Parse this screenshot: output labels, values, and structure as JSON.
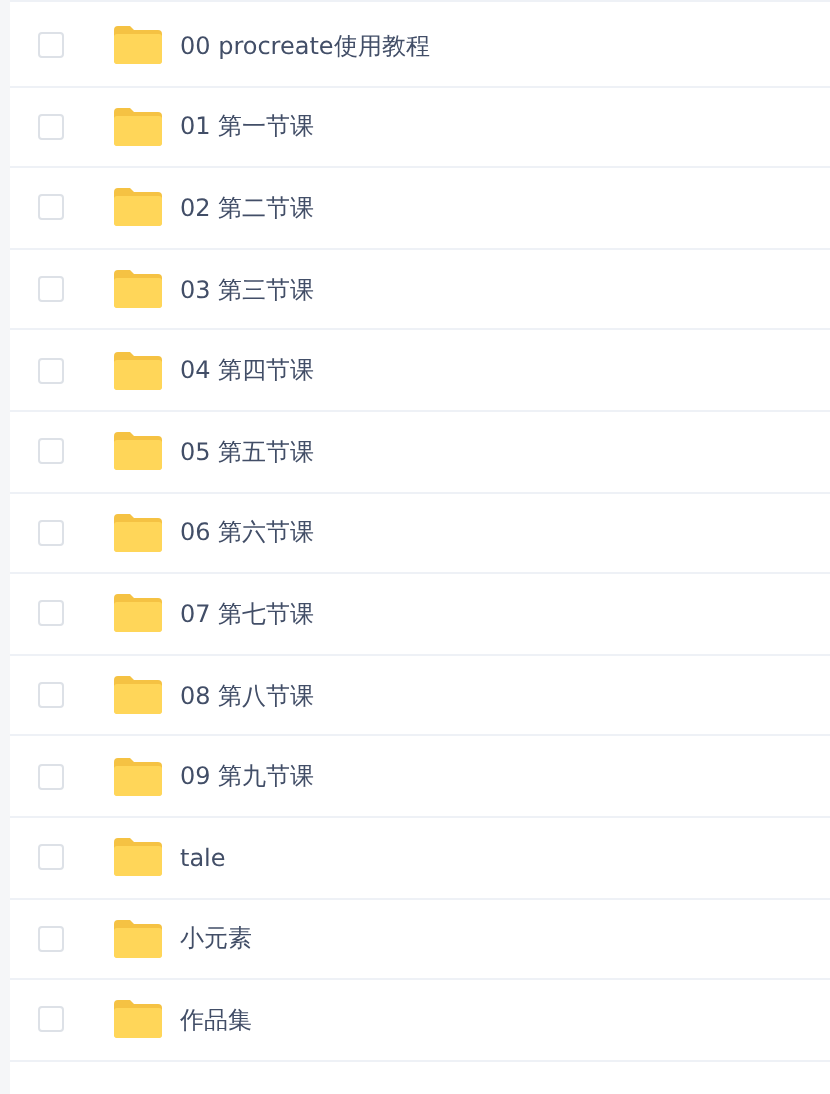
{
  "files": [
    {
      "name": "00 procreate使用教程",
      "checked": false
    },
    {
      "name": "01 第一节课",
      "checked": false
    },
    {
      "name": "02 第二节课",
      "checked": false
    },
    {
      "name": "03 第三节课",
      "checked": false
    },
    {
      "name": "04 第四节课",
      "checked": false
    },
    {
      "name": "05 第五节课",
      "checked": false
    },
    {
      "name": "06 第六节课",
      "checked": false
    },
    {
      "name": "07 第七节课",
      "checked": false
    },
    {
      "name": "08 第八节课",
      "checked": false
    },
    {
      "name": "09 第九节课",
      "checked": false
    },
    {
      "name": "tale",
      "checked": false
    },
    {
      "name": "小元素",
      "checked": false
    },
    {
      "name": "作品集",
      "checked": false
    }
  ]
}
